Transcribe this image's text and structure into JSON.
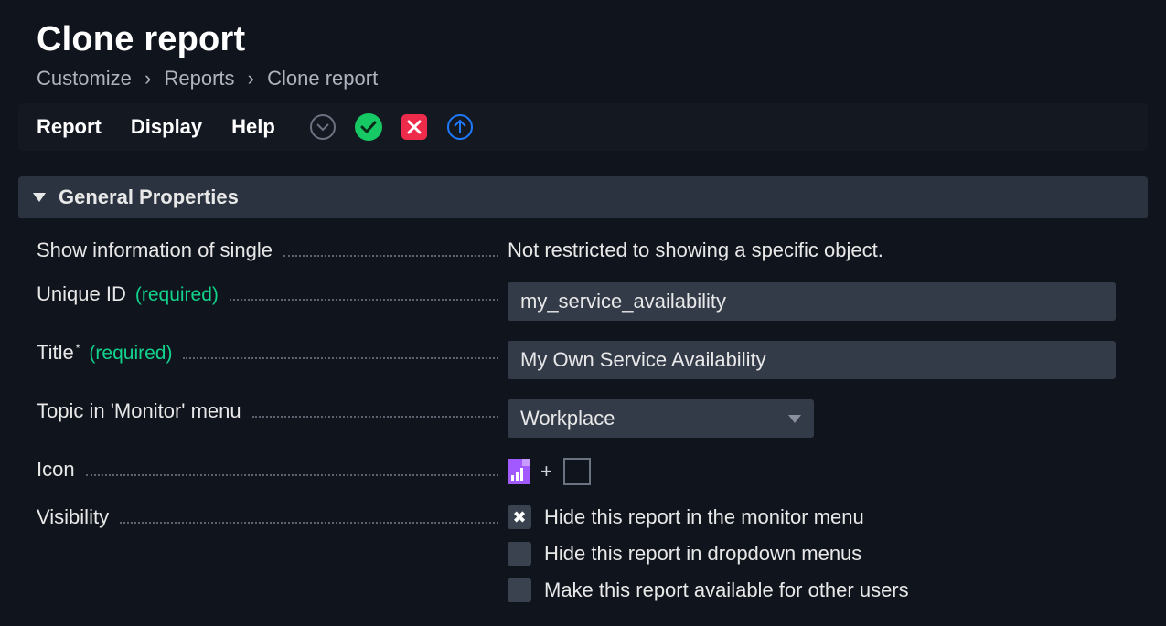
{
  "page_title": "Clone report",
  "breadcrumb": {
    "a": "Customize",
    "b": "Reports",
    "c": "Clone report"
  },
  "toolbar": {
    "report": "Report",
    "display": "Display",
    "help": "Help"
  },
  "section": {
    "title": "General Properties"
  },
  "labels": {
    "show_single": "Show information of single",
    "unique_id": "Unique ID",
    "title": "Title",
    "topic": "Topic in 'Monitor' menu",
    "icon": "Icon",
    "visibility": "Visibility",
    "required": "(required)"
  },
  "values": {
    "show_single": "Not restricted to showing a specific object.",
    "unique_id": "my_service_availability",
    "title": "My Own Service Availability",
    "topic_selected": "Workplace"
  },
  "checks": {
    "hide_monitor": "Hide this report in the monitor menu",
    "hide_dropdown": "Hide this report in dropdown menus",
    "share": "Make this report available for other users"
  },
  "glyphs": {
    "plus": "+",
    "x": "✖"
  }
}
